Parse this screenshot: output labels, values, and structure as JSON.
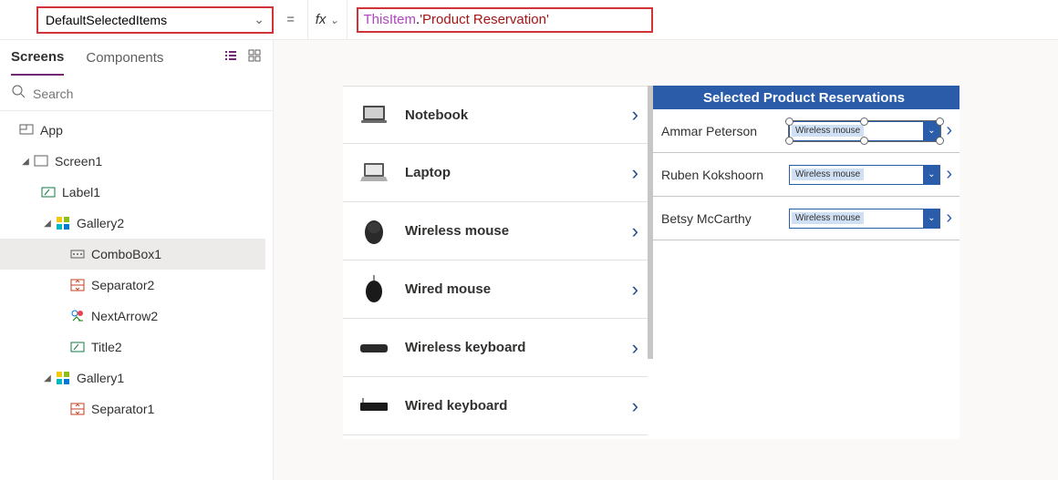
{
  "formula_bar": {
    "property": "DefaultSelectedItems",
    "equals": "=",
    "fx_label": "fx",
    "formula_this": "ThisItem",
    "formula_dot": ".",
    "formula_str": "'Product Reservation'"
  },
  "left_panel": {
    "tabs": {
      "screens": "Screens",
      "components": "Components"
    },
    "search_placeholder": "Search",
    "tree": {
      "app": "App",
      "screen1": "Screen1",
      "label1": "Label1",
      "gallery2": "Gallery2",
      "combobox1": "ComboBox1",
      "separator2": "Separator2",
      "nextarrow2": "NextArrow2",
      "title2": "Title2",
      "gallery1": "Gallery1",
      "separator1": "Separator1"
    }
  },
  "products": [
    "Notebook",
    "Laptop",
    "Wireless mouse",
    "Wired mouse",
    "Wireless keyboard",
    "Wired keyboard"
  ],
  "reservations": {
    "header": "Selected Product Reservations",
    "rows": [
      {
        "name": "Ammar Peterson",
        "value": "Wireless mouse"
      },
      {
        "name": "Ruben Kokshoorn",
        "value": "Wireless mouse"
      },
      {
        "name": "Betsy McCarthy",
        "value": "Wireless mouse"
      }
    ]
  }
}
